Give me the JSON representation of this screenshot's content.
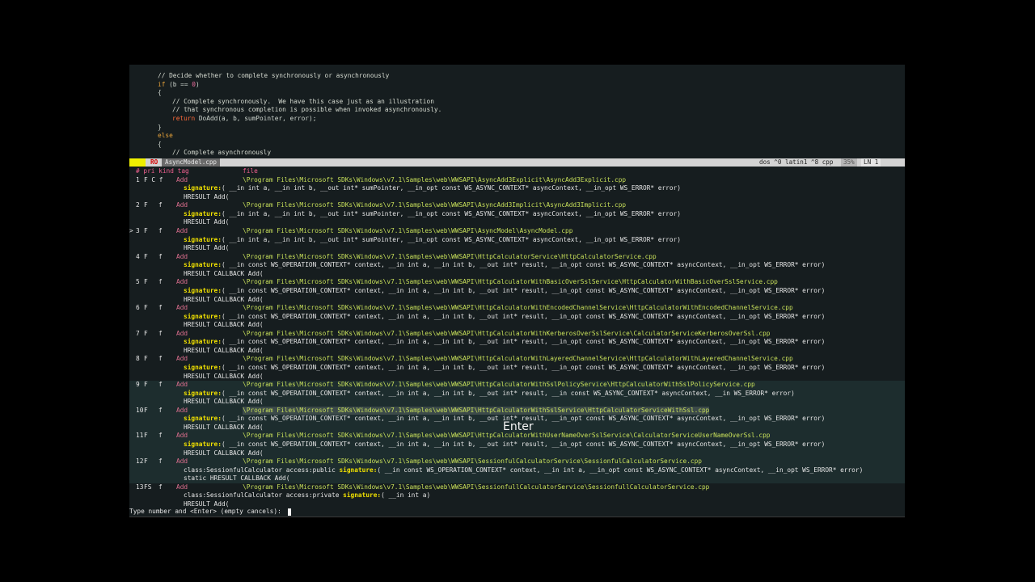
{
  "code": {
    "lines": [
      {
        "indent": 1,
        "segments": [
          {
            "t": "// Decide whether to complete synchronously or asynchronously",
            "c": "cmt"
          }
        ]
      },
      {
        "indent": 1,
        "segments": [
          {
            "t": "if",
            "c": "kw"
          },
          {
            "t": " (b == ",
            "c": ""
          },
          {
            "t": "0",
            "c": "num"
          },
          {
            "t": ")",
            "c": ""
          }
        ]
      },
      {
        "indent": 1,
        "segments": [
          {
            "t": "{",
            "c": ""
          }
        ]
      },
      {
        "indent": 2,
        "segments": [
          {
            "t": "// Complete synchronously.  We have this case just as an illustration",
            "c": "cmt"
          }
        ]
      },
      {
        "indent": 2,
        "segments": [
          {
            "t": "// that synchronous completion is possible when invoked asynchronously.",
            "c": "cmt"
          }
        ]
      },
      {
        "indent": 2,
        "segments": [
          {
            "t": "return",
            "c": "ret"
          },
          {
            "t": " DoAdd(a, b, sumPointer, error);",
            "c": ""
          }
        ]
      },
      {
        "indent": 1,
        "segments": [
          {
            "t": "}",
            "c": ""
          }
        ]
      },
      {
        "indent": 1,
        "segments": [
          {
            "t": "else",
            "c": "kw"
          }
        ]
      },
      {
        "indent": 1,
        "segments": [
          {
            "t": "{",
            "c": ""
          }
        ]
      },
      {
        "indent": 2,
        "segments": [
          {
            "t": "// Complete asynchronously",
            "c": "cmt"
          }
        ]
      }
    ]
  },
  "status": {
    "mode": "N",
    "ro": "RO",
    "filename": "AsyncModel.cpp",
    "right": "dos ^0 latin1 ^8 cpp",
    "percent": "35%",
    "line": "LN 1"
  },
  "table": {
    "headers": {
      "num": "# pri kind tag",
      "file": "file"
    },
    "rows": [
      {
        "num": "1",
        "pri": "F C f",
        "kind": "",
        "tag": "Add",
        "file": "\\Program Files\\Microsoft SDKs\\Windows\\v7.1\\Samples\\web\\WWSAPI\\AsyncAdd3Explicit\\AsyncAdd3Explicit.cpp",
        "sig_prefix": "",
        "sig": "( __in int a, __in int b, __out int* sumPointer, __in_opt const WS_ASYNC_CONTEXT* asyncContext, __in_opt WS_ERROR* error)",
        "ctx": "HRESULT Add(",
        "marker": ""
      },
      {
        "num": "2",
        "pri": "F",
        "kind": "f",
        "tag": "Add",
        "file": "\\Program Files\\Microsoft SDKs\\Windows\\v7.1\\Samples\\web\\WWSAPI\\AsyncAdd3Implicit\\AsyncAdd3Implicit.cpp",
        "sig_prefix": "",
        "sig": "( __in int a, __in int b, __out int* sumPointer, __in_opt const WS_ASYNC_CONTEXT* asyncContext, __in_opt WS_ERROR* error)",
        "ctx": "HRESULT Add(",
        "marker": ""
      },
      {
        "num": "3",
        "pri": "F",
        "kind": "f",
        "tag": "Add",
        "file": "\\Program Files\\Microsoft SDKs\\Windows\\v7.1\\Samples\\web\\WWSAPI\\AsyncModel\\AsyncModel.cpp",
        "sig_prefix": "",
        "sig": "( __in int a, __in int b, __out int* sumPointer, __in_opt const WS_ASYNC_CONTEXT* asyncContext, __in_opt WS_ERROR* error)",
        "ctx": "HRESULT Add(",
        "marker": ">"
      },
      {
        "num": "4",
        "pri": "F",
        "kind": "f",
        "tag": "Add",
        "file": "\\Program Files\\Microsoft SDKs\\Windows\\v7.1\\Samples\\web\\WWSAPI\\HttpCalculatorService\\HttpCalculatorService.cpp",
        "sig_prefix": "",
        "sig": "( __in const WS_OPERATION_CONTEXT* context, __in int a, __in int b, __out int* result, __in_opt const WS_ASYNC_CONTEXT* asyncContext, __in_opt WS_ERROR* error)",
        "ctx": "HRESULT CALLBACK Add(",
        "marker": ""
      },
      {
        "num": "5",
        "pri": "F",
        "kind": "f",
        "tag": "Add",
        "file": "\\Program Files\\Microsoft SDKs\\Windows\\v7.1\\Samples\\web\\WWSAPI\\HttpCalculatorWithBasicOverSslService\\HttpCalculatorWithBasicOverSslService.cpp",
        "sig_prefix": "",
        "sig": "( __in const WS_OPERATION_CONTEXT* context, __in int a, __in int b, __out int* result, __in_opt const WS_ASYNC_CONTEXT* asyncContext, __in_opt WS_ERROR* error)",
        "ctx": "HRESULT CALLBACK Add(",
        "marker": ""
      },
      {
        "num": "6",
        "pri": "F",
        "kind": "f",
        "tag": "Add",
        "file": "\\Program Files\\Microsoft SDKs\\Windows\\v7.1\\Samples\\web\\WWSAPI\\HttpCalculatorWithEncodedChannelService\\HttpCalculatorWithEncodedChannelService.cpp",
        "sig_prefix": "",
        "sig": "( __in const WS_OPERATION_CONTEXT* context, __in int a, __in int b, __out int* result, __in_opt const WS_ASYNC_CONTEXT* asyncContext, __in_opt WS_ERROR* error)",
        "ctx": "HRESULT CALLBACK Add(",
        "marker": ""
      },
      {
        "num": "7",
        "pri": "F",
        "kind": "f",
        "tag": "Add",
        "file": "\\Program Files\\Microsoft SDKs\\Windows\\v7.1\\Samples\\web\\WWSAPI\\HttpCalculatorWithKerberosOverSslService\\CalculatorServiceKerberosOverSsl.cpp",
        "sig_prefix": "",
        "sig": "( __in const WS_OPERATION_CONTEXT* context, __in int a, __in int b, __out int* result, __in_opt const WS_ASYNC_CONTEXT* asyncContext, __in_opt WS_ERROR* error)",
        "ctx": "HRESULT CALLBACK Add(",
        "marker": ""
      },
      {
        "num": "8",
        "pri": "F",
        "kind": "f",
        "tag": "Add",
        "file": "\\Program Files\\Microsoft SDKs\\Windows\\v7.1\\Samples\\web\\WWSAPI\\HttpCalculatorWithLayeredChannelService\\HttpCalculatorWithLayeredChannelService.cpp",
        "sig_prefix": "",
        "sig": "( __in const WS_OPERATION_CONTEXT* context, __in int a, __in int b, __out int* result, __in_opt const WS_ASYNC_CONTEXT* asyncContext, __in_opt WS_ERROR* error)",
        "ctx": "HRESULT CALLBACK Add(",
        "marker": ""
      },
      {
        "num": "9",
        "pri": "F",
        "kind": "f",
        "tag": "Add",
        "file": "\\Program Files\\Microsoft SDKs\\Windows\\v7.1\\Samples\\web\\WWSAPI\\HttpCalculatorWithSslPolicyService\\HttpCalculatorWithSslPolicyService.cpp",
        "sig_prefix": "",
        "sig": "( __in const WS_OPERATION_CONTEXT* context, __in int a, __in int b, __out int* result, __in const WS_ASYNC_CONTEXT* asyncContext, __in WS_ERROR* error)",
        "ctx": "HRESULT CALLBACK Add(",
        "marker": ""
      },
      {
        "num": "10",
        "pri": "F",
        "kind": "f",
        "tag": "Add",
        "file": "\\Program Files\\Microsoft SDKs\\Windows\\v7.1\\Samples\\web\\WWSAPI\\HttpCalculatorWithSslService\\HttpCalculatorServiceWithSsl.cpp",
        "sig_prefix": "",
        "sig": "( __in const WS_OPERATION_CONTEXT* context, __in int a, __in int b, __out int* result, __in_opt const WS_ASYNC_CONTEXT* asyncContext, __in_opt WS_ERROR* error)",
        "ctx": "HRESULT CALLBACK Add(",
        "marker": "",
        "selected": true
      },
      {
        "num": "11",
        "pri": "F",
        "kind": "f",
        "tag": "Add",
        "file": "\\Program Files\\Microsoft SDKs\\Windows\\v7.1\\Samples\\web\\WWSAPI\\HttpCalculatorWithUserNameOverSslService\\CalculatorServiceUserNameOverSsl.cpp",
        "sig_prefix": "",
        "sig": "( __in const WS_OPERATION_CONTEXT* context, __in int a, __in int b, __out int* result, __in_opt const WS_ASYNC_CONTEXT* asyncContext, __in_opt WS_ERROR* error)",
        "ctx": "HRESULT CALLBACK Add(",
        "marker": ""
      },
      {
        "num": "12",
        "pri": "F",
        "kind": "f",
        "tag": "Add",
        "file": "\\Program Files\\Microsoft SDKs\\Windows\\v7.1\\Samples\\web\\WWSAPI\\SessionfulCalculatorService\\SessionfulCalculatorService.cpp",
        "sig_prefix": "class:SessionfulCalculator access:public ",
        "sig": "( __in const WS_OPERATION_CONTEXT* context, __in int a, __in_opt const WS_ASYNC_CONTEXT* asyncContext, __in_opt WS_ERROR* error)",
        "ctx": "static HRESULT CALLBACK Add(",
        "marker": ""
      },
      {
        "num": "13",
        "pri": "FS",
        "kind": "f",
        "tag": "Add",
        "file": "\\Program Files\\Microsoft SDKs\\Windows\\v7.1\\Samples\\web\\WWSAPI\\SessionfullCalculatorService\\SessionfullCalculatorService.cpp",
        "sig_prefix": "class:SessionfulCalculator access:private ",
        "sig": "( __in int a)",
        "ctx": "HRESULT Add(",
        "marker": ""
      }
    ]
  },
  "prompt": "Type number and <Enter> (empty cancels): ",
  "overlay": "Enter"
}
